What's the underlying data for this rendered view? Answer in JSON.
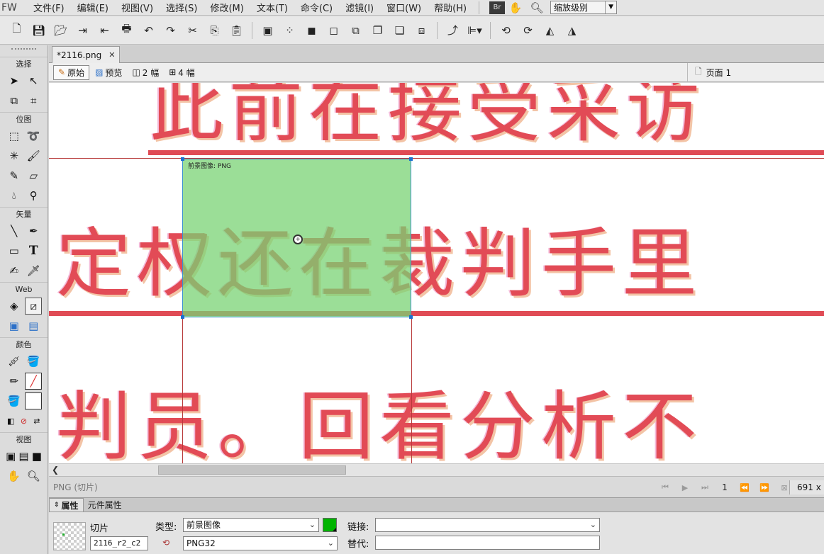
{
  "app": {
    "logo": "FW",
    "menus": [
      "文件(F)",
      "编辑(E)",
      "视图(V)",
      "选择(S)",
      "修改(M)",
      "文本(T)",
      "命令(C)",
      "滤镜(I)",
      "窗口(W)",
      "帮助(H)"
    ],
    "bridge_badge": "Br",
    "zoom_label": "缩放级别"
  },
  "tools": {
    "section_select": "选择",
    "section_bitmap": "位图",
    "section_vector": "矢量",
    "section_web": "Web",
    "section_color": "颜色",
    "section_view": "视图"
  },
  "document": {
    "tab_title": "*2116.png",
    "view_original": "原始",
    "view_preview": "预览",
    "view_2up": "2 幅",
    "view_4up": "4 幅",
    "page_label": "页面 1"
  },
  "canvas": {
    "line1": "此前在接受采访",
    "line2": "定权还在裁判手里",
    "line3": "判员。回看分析不",
    "slice_label": "前景图像: PNG",
    "colors": {
      "text": "#e24b56",
      "slice_fill": "#78d273",
      "slice_border": "#3a8fd0"
    }
  },
  "status": {
    "left_text": "PNG (切片)",
    "page_number": "1",
    "dims_text": "691 x"
  },
  "properties": {
    "tab_props": "属性",
    "tab_symbol": "元件属性",
    "object_type": "切片",
    "slice_name": "2116_r2_c2",
    "type_label": "类型:",
    "type_value": "前景图像",
    "format_value": "PNG32",
    "link_label": "链接:",
    "alt_label": "替代:",
    "link_value": "",
    "alt_value": "",
    "slice_color": "#00b400"
  }
}
